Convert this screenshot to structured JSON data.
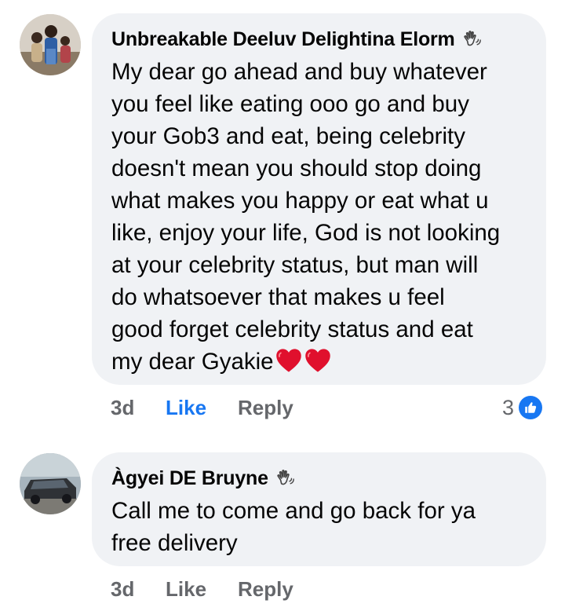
{
  "comments": [
    {
      "author": "Unbreakable Deeluv Delightina Elorm",
      "author_badge": "wave-hand-icon",
      "text": "My dear go ahead and buy whatever\nyou feel like eating ooo go and buy\nyour Gob3 and eat, being celebrity\ndoesn't mean you should stop doing\nwhat makes you happy or eat what u\nlike, enjoy your life, God is not looking\nat your celebrity status, but man will\ndo whatsoever that makes u feel\ngood forget celebrity status and eat\nmy dear Gyakie",
      "emojis": [
        "red-heart-icon",
        "red-heart-icon"
      ],
      "time": "3d",
      "like_label": "Like",
      "like_active": true,
      "reply_label": "Reply",
      "reaction_count": "3",
      "reaction_type": "like-icon"
    },
    {
      "author": "Àgyei DE Bruyne",
      "author_badge": "wave-hand-icon",
      "text": "Call me to come and go back for ya\nfree delivery",
      "time": "3d",
      "like_label": "Like",
      "like_active": false,
      "reply_label": "Reply"
    }
  ],
  "colors": {
    "bubble": "#f0f2f5",
    "meta_text": "#65676b",
    "like_active": "#1877f2",
    "heart": "#e0102d"
  }
}
